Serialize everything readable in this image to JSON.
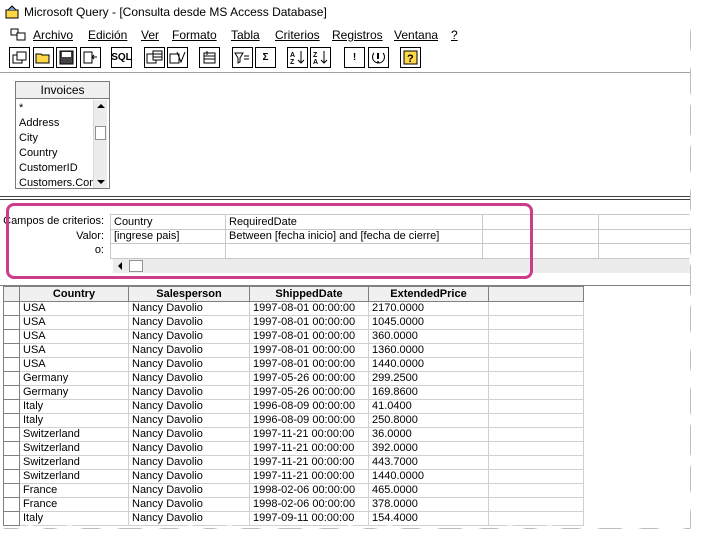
{
  "window": {
    "title": "Microsoft Query - [Consulta desde MS Access Database]"
  },
  "menu": [
    "Archivo",
    "Edición",
    "Ver",
    "Formato",
    "Tabla",
    "Criterios",
    "Registros",
    "Ventana",
    "?"
  ],
  "toolbar": {
    "sql_label": "SQL",
    "sigma_label": "Σ",
    "exclaim_label": "!"
  },
  "table_box": {
    "name": "Invoices",
    "fields": [
      "*",
      "Address",
      "City",
      "Country",
      "CustomerID",
      "Customers.Com"
    ]
  },
  "criteria": {
    "row_labels": [
      "Campos de criterios:",
      "Valor:",
      "o:"
    ],
    "fields": [
      "Country",
      "RequiredDate"
    ],
    "values": [
      "[ingrese pais]",
      "Between [fecha inicio] and [fecha de cierre]"
    ]
  },
  "grid": {
    "columns": [
      "Country",
      "Salesperson",
      "ShippedDate",
      "ExtendedPrice"
    ],
    "rows": [
      [
        "USA",
        "Nancy Davolio",
        "1997-08-01 00:00:00",
        "2170.0000"
      ],
      [
        "USA",
        "Nancy Davolio",
        "1997-08-01 00:00:00",
        "1045.0000"
      ],
      [
        "USA",
        "Nancy Davolio",
        "1997-08-01 00:00:00",
        "360.0000"
      ],
      [
        "USA",
        "Nancy Davolio",
        "1997-08-01 00:00:00",
        "1360.0000"
      ],
      [
        "USA",
        "Nancy Davolio",
        "1997-08-01 00:00:00",
        "1440.0000"
      ],
      [
        "Germany",
        "Nancy Davolio",
        "1997-05-26 00:00:00",
        "299.2500"
      ],
      [
        "Germany",
        "Nancy Davolio",
        "1997-05-26 00:00:00",
        "169.8600"
      ],
      [
        "Italy",
        "Nancy Davolio",
        "1996-08-09 00:00:00",
        "41.0400"
      ],
      [
        "Italy",
        "Nancy Davolio",
        "1996-08-09 00:00:00",
        "250.8000"
      ],
      [
        "Switzerland",
        "Nancy Davolio",
        "1997-11-21 00:00:00",
        "36.0000"
      ],
      [
        "Switzerland",
        "Nancy Davolio",
        "1997-11-21 00:00:00",
        "392.0000"
      ],
      [
        "Switzerland",
        "Nancy Davolio",
        "1997-11-21 00:00:00",
        "443.7000"
      ],
      [
        "Switzerland",
        "Nancy Davolio",
        "1997-11-21 00:00:00",
        "1440.0000"
      ],
      [
        "France",
        "Nancy Davolio",
        "1998-02-06 00:00:00",
        "465.0000"
      ],
      [
        "France",
        "Nancy Davolio",
        "1998-02-06 00:00:00",
        "378.0000"
      ],
      [
        "Italy",
        "Nancy Davolio",
        "1997-09-11 00:00:00",
        "154.4000"
      ]
    ]
  },
  "colors": {
    "highlight": "#cc3d89"
  }
}
